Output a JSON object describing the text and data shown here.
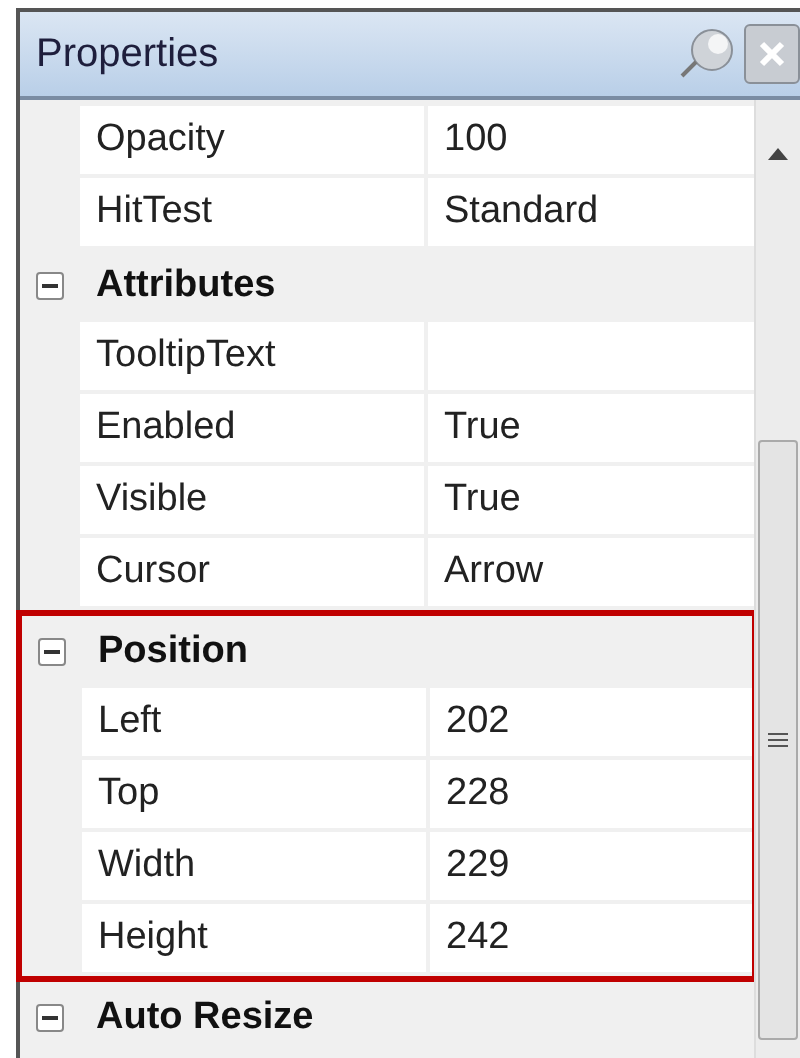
{
  "window": {
    "title": "Properties"
  },
  "rows": [
    {
      "kind": "property",
      "name": "Opacity",
      "value": "100"
    },
    {
      "kind": "property",
      "name": "HitTest",
      "value": "Standard"
    },
    {
      "kind": "group",
      "name": "Attributes",
      "expanded": true,
      "highlighted": false
    },
    {
      "kind": "property",
      "name": "TooltipText",
      "value": ""
    },
    {
      "kind": "property",
      "name": "Enabled",
      "value": "True"
    },
    {
      "kind": "property",
      "name": "Visible",
      "value": "True"
    },
    {
      "kind": "property",
      "name": "Cursor",
      "value": "Arrow"
    },
    {
      "kind": "group",
      "name": "Position",
      "expanded": true,
      "highlighted": true,
      "children": [
        {
          "kind": "property",
          "name": "Left",
          "value": "202"
        },
        {
          "kind": "property",
          "name": "Top",
          "value": "228"
        },
        {
          "kind": "property",
          "name": "Width",
          "value": "229"
        },
        {
          "kind": "property",
          "name": "Height",
          "value": "242"
        }
      ]
    },
    {
      "kind": "group",
      "name": "Auto Resize",
      "expanded": true,
      "highlighted": false
    }
  ]
}
